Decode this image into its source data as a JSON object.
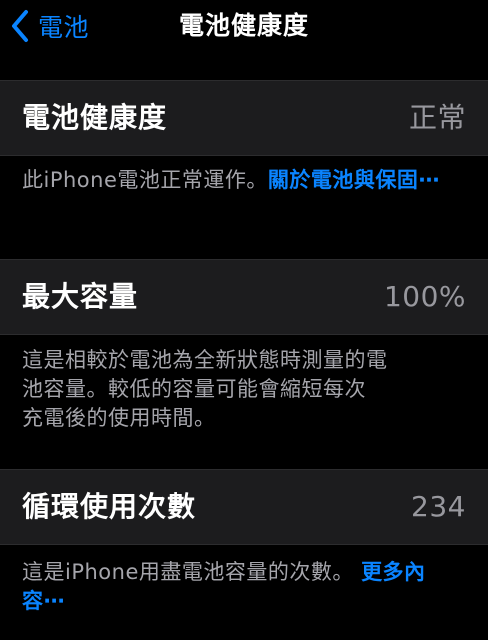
{
  "nav": {
    "back_label": "電池",
    "title": "電池健康度"
  },
  "health": {
    "label": "電池健康度",
    "value": "正常",
    "footer_text": "此iPhone電池正常運作。",
    "footer_link": "關於電池與保固⋯"
  },
  "capacity": {
    "label": "最大容量",
    "value": "100%",
    "footer_line1": "這是相較於電池為全新狀態時測量的電",
    "footer_line2": "池容量。較低的容量可能會縮短每次",
    "footer_line3": "充電後的使用時間。"
  },
  "cycles": {
    "label": "循環使用次數",
    "value": "234",
    "footer_text": "這是iPhone用盡電池容量的次數。 ",
    "footer_link": "更多內容⋯"
  },
  "colors": {
    "accent": "#0a84ff",
    "background": "#000000",
    "cell": "#1c1c1e",
    "secondary_text": "#98989e"
  },
  "icons": {
    "back": "chevron-left-icon"
  }
}
